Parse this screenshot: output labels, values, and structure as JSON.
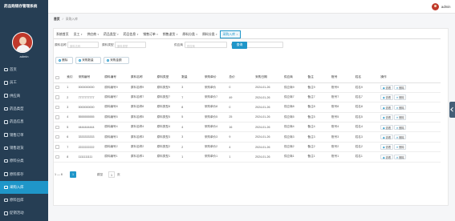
{
  "app": {
    "title": "药品购销存管理系统",
    "username": "admin"
  },
  "menu": [
    {
      "label": "首页"
    },
    {
      "label": "员工"
    },
    {
      "label": "供应商"
    },
    {
      "label": "药品类型"
    },
    {
      "label": "药品信息"
    },
    {
      "label": "销售订单"
    },
    {
      "label": "销售退货"
    },
    {
      "label": "原料分类"
    },
    {
      "label": "原料库存"
    },
    {
      "label": "采购入库"
    },
    {
      "label": "原料出库"
    },
    {
      "label": "促销活动"
    }
  ],
  "breadcrumb": {
    "home": "首页",
    "sep": "/",
    "current": "采购入库"
  },
  "tabs": [
    {
      "label": "系统首页",
      "caret": ""
    },
    {
      "label": "员工",
      "caret": "▾"
    },
    {
      "label": "供应商",
      "caret": "▾"
    },
    {
      "label": "药品类型",
      "caret": "▾"
    },
    {
      "label": "药品信息",
      "caret": "▾"
    },
    {
      "label": "销售订单",
      "caret": "▾"
    },
    {
      "label": "销售退货",
      "caret": "▾"
    },
    {
      "label": "原料分类",
      "caret": "▾"
    },
    {
      "label": "原料分类",
      "caret": "▾"
    },
    {
      "label": "采购入库",
      "caret": "×"
    }
  ],
  "filters": {
    "f1_label": "原料名称",
    "f1_placeholder": "原料名称",
    "f2_label": "原料类型",
    "f2_placeholder": "原料类型",
    "f3_label": "供应商",
    "f3_placeholder": "供应商",
    "f4_label": "供应商",
    "f4_placeholder": "",
    "search": "查询"
  },
  "actions": {
    "delete": "删除",
    "report1": "采购数量",
    "report2": "采购金额"
  },
  "table": {
    "headers": [
      "",
      "索引",
      "采购编号",
      "原料编号",
      "原料名称",
      "原料类型",
      "数量",
      "采购单价",
      "总价",
      "采购日期",
      "供应商",
      "备注",
      "账号",
      "姓名",
      "操作"
    ],
    "rows": [
      [
        "1",
        "0000000000",
        "原料编号9",
        "原料名称9",
        "原料类型9",
        "3",
        "采购单价",
        "0",
        "2024-01-26",
        "供应商9",
        "备注9",
        "账号9",
        "姓名9"
      ],
      [
        "2",
        "7777777777",
        "原料编号7",
        "原料名称7",
        "原料类型7",
        "7",
        "采购单价7",
        "49",
        "2024-01-26",
        "供应商7",
        "备注7",
        "账号7",
        "姓名7"
      ],
      [
        "3",
        "0000000000",
        "原料编号8",
        "原料名称8",
        "原料类型8",
        "8",
        "采购单价8",
        "0",
        "2024-01-26",
        "供应商8",
        "备注8",
        "账号8",
        "姓名8"
      ],
      [
        "4",
        "5555555555",
        "原料编号5",
        "原料名称5",
        "原料类型5",
        "5",
        "采购单价5",
        "25",
        "2024-01-26",
        "供应商5",
        "备注5",
        "账号5",
        "姓名5"
      ],
      [
        "5",
        "4444444444",
        "原料编号4",
        "原料名称4",
        "原料类型4",
        "4",
        "采购单价4",
        "16",
        "2024-01-26",
        "供应商4",
        "备注4",
        "账号4",
        "姓名4"
      ],
      [
        "6",
        "3333333333",
        "原料编号3",
        "原料名称3",
        "原料类型3",
        "3",
        "采购单价3",
        "9",
        "2024-01-26",
        "供应商3",
        "备注3",
        "账号3",
        "姓名3"
      ],
      [
        "7",
        "2222222222",
        "原料编号2",
        "原料名称2",
        "原料类型2",
        "2",
        "采购单价2",
        "4",
        "2024-01-26",
        "供应商2",
        "备注2",
        "账号2",
        "姓名2"
      ],
      [
        "8",
        "1111111111",
        "原料编号1",
        "原料名称1",
        "原料类型1",
        "1",
        "采购单价1",
        "1",
        "2024-01-26",
        "供应商1",
        "备注1",
        "账号1",
        "姓名1"
      ]
    ],
    "op_view": "查看",
    "op_delete": "删除"
  },
  "pager": {
    "prev": "1 — 8",
    "current": "1",
    "jump": "跳至",
    "page_value": "1",
    "page_unit": "页"
  },
  "colors": {
    "sidebar": "#263e54",
    "accent": "#1f96c9",
    "avatar": "#c0392b"
  }
}
